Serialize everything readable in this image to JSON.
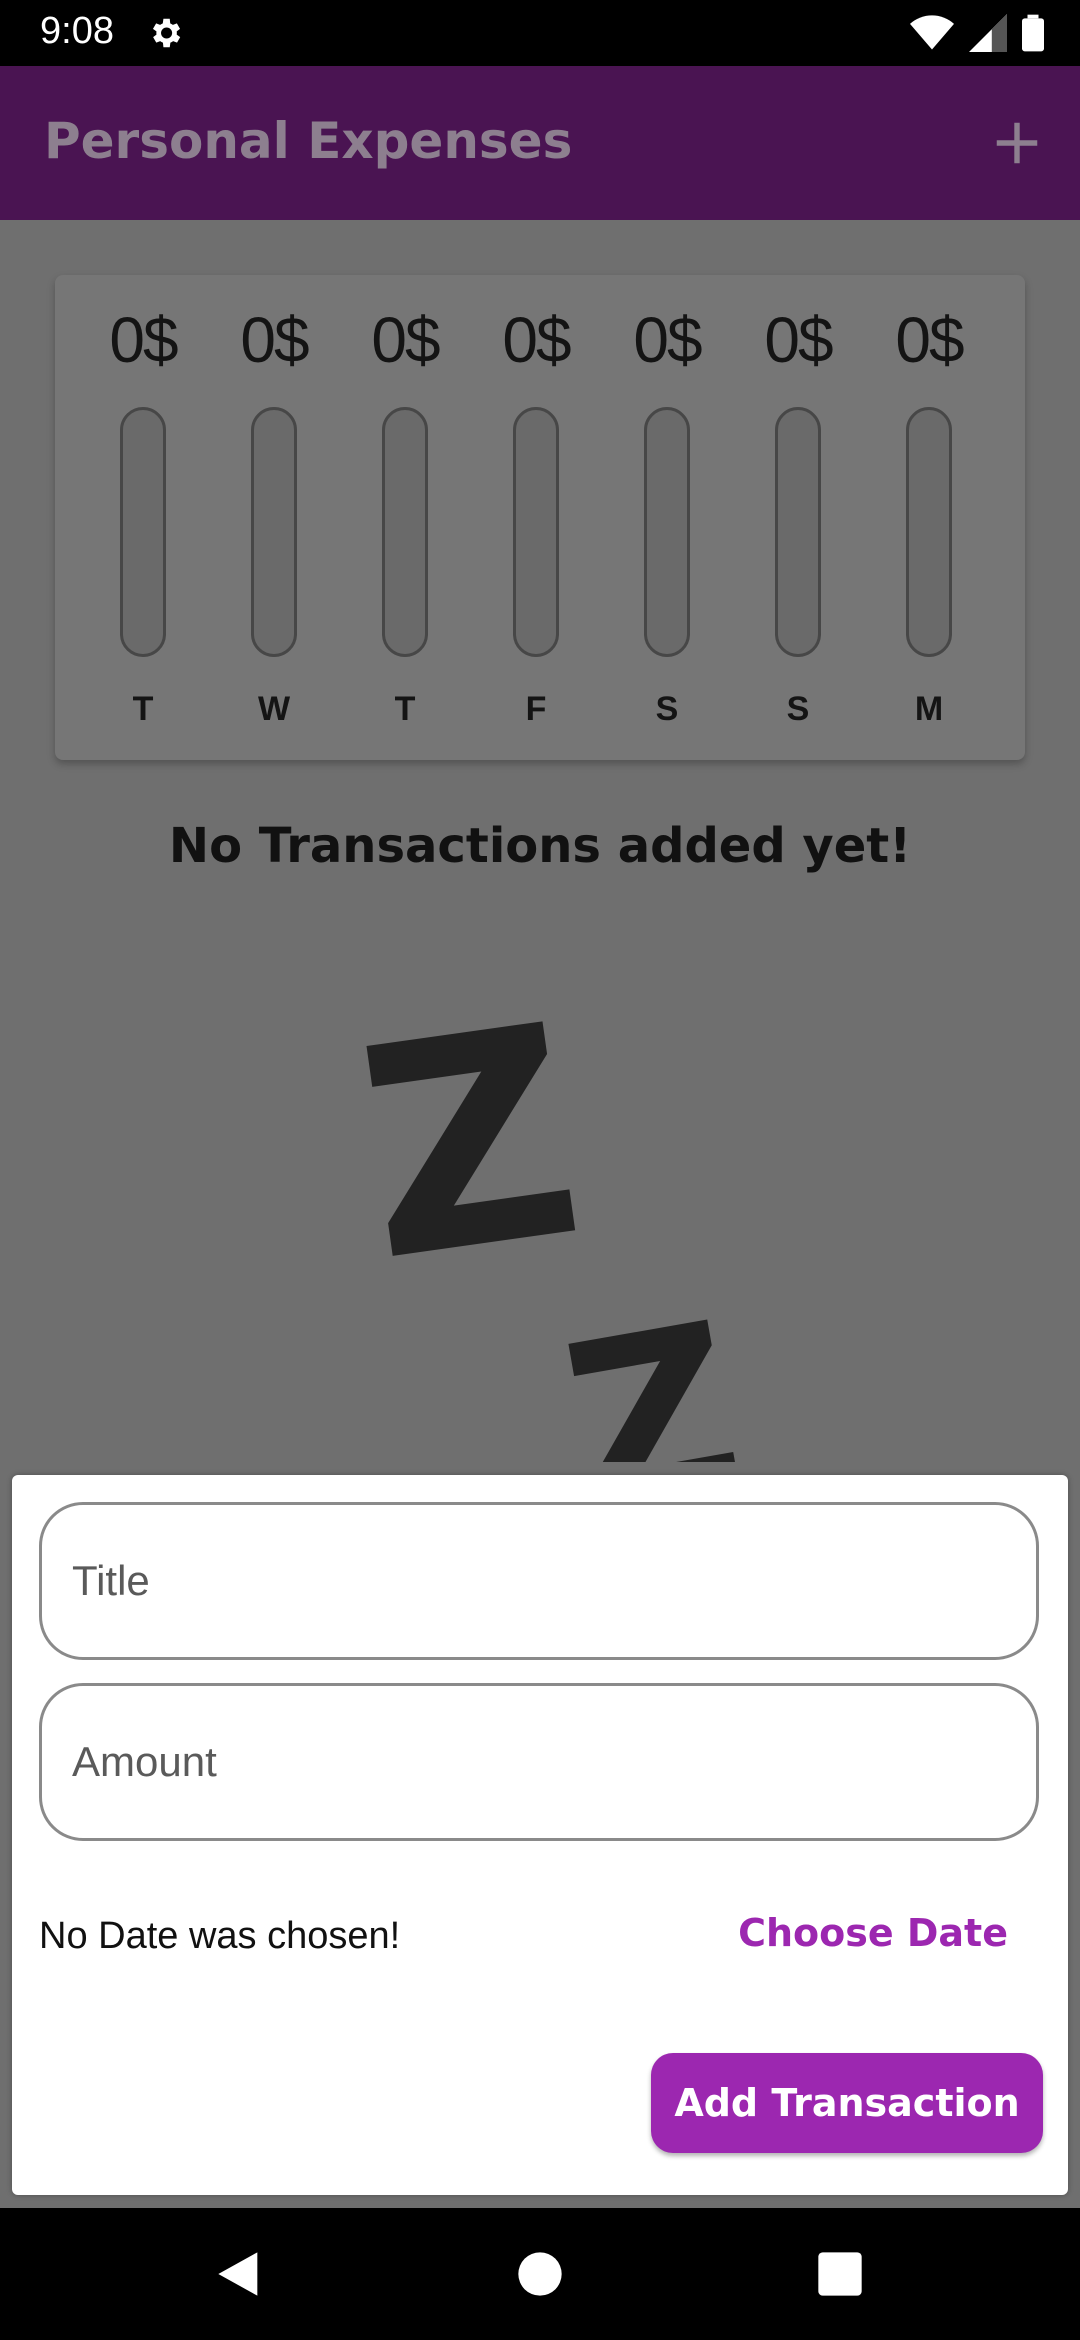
{
  "status_bar": {
    "time": "9:08"
  },
  "app_bar": {
    "title": "Personal Expenses"
  },
  "chart": {
    "bars": [
      {
        "amount": "0$",
        "day": "T",
        "fill": 0
      },
      {
        "amount": "0$",
        "day": "W",
        "fill": 0
      },
      {
        "amount": "0$",
        "day": "T",
        "fill": 0
      },
      {
        "amount": "0$",
        "day": "F",
        "fill": 0
      },
      {
        "amount": "0$",
        "day": "S",
        "fill": 0
      },
      {
        "amount": "0$",
        "day": "S",
        "fill": 0
      },
      {
        "amount": "0$",
        "day": "M",
        "fill": 0
      }
    ]
  },
  "empty_state": {
    "message": "No Transactions added yet!",
    "z1": "Z",
    "z2": "Z"
  },
  "form": {
    "title_placeholder": "Title",
    "amount_placeholder": "Amount",
    "date_status": "No Date was chosen!",
    "choose_date_label": "Choose Date",
    "add_label": "Add Transaction"
  },
  "colors": {
    "primary": "#9c27b0",
    "app_bar": "#4a1452"
  }
}
